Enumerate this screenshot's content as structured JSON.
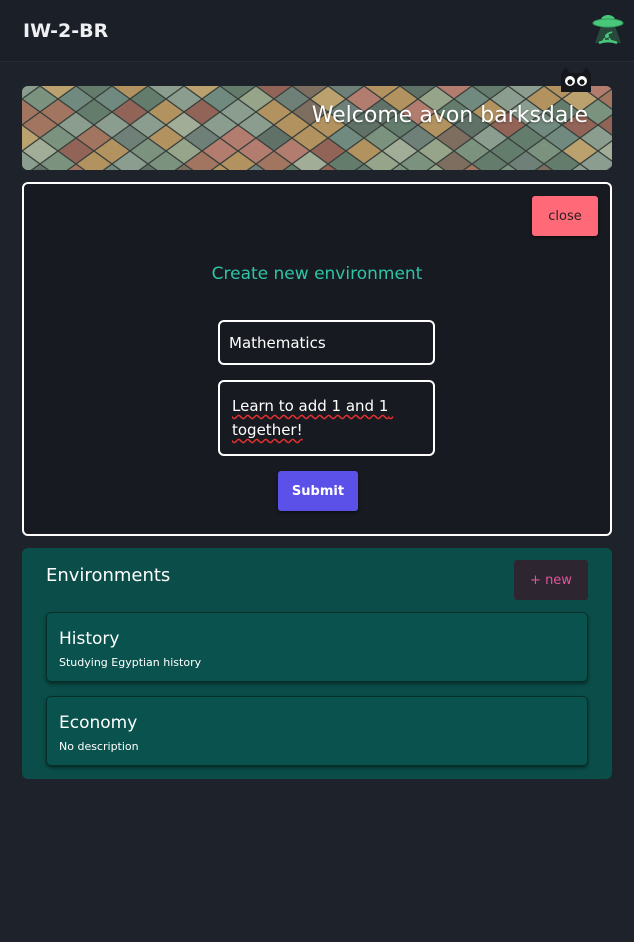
{
  "header": {
    "app_title": "IW-2-BR",
    "logo_icon": "ufo-icon"
  },
  "banner": {
    "welcome_text": "Welcome avon barksdale",
    "mascot_icon": "cat-icon"
  },
  "create_form": {
    "close_label": "close",
    "title": "Create new environment",
    "name_value": "Mathematics",
    "description_value": "Learn to add 1 and 1 together!",
    "submit_label": "Submit"
  },
  "environments": {
    "title": "Environments",
    "new_label": "+ new",
    "items": [
      {
        "name": "History",
        "description": "Studying Egyptian history"
      },
      {
        "name": "Economy",
        "description": "No description"
      }
    ]
  },
  "colors": {
    "background": "#1e222b",
    "panel": "#171a20",
    "accent_teal": "#2ec4a5",
    "environments_panel": "#0b4d48",
    "close_button": "#ff6978",
    "submit_button": "#5b50e8",
    "new_button_text": "#e0559a",
    "logo_green": "#49c87c"
  }
}
